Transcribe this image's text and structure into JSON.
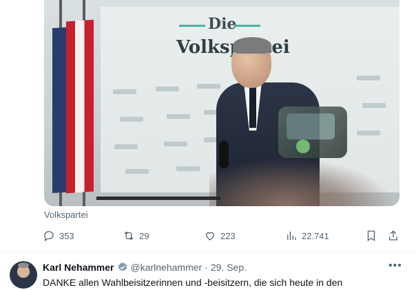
{
  "media": {
    "logo_top": "Die",
    "logo_main": "Volkspartei",
    "source_label": "Volkspartei"
  },
  "actions": {
    "replies": "353",
    "reposts": "29",
    "likes": "223",
    "views": "22.741"
  },
  "next_tweet": {
    "display_name": "Karl Nehammer",
    "handle": "@karlnehammer",
    "separator": "·",
    "date": "29. Sep.",
    "text": "DANKE allen Wahlbeisitzerinnen und -beisitzern, die sich heute in den"
  },
  "colors": {
    "secondary_text": "#536471",
    "primary_text": "#0f1419",
    "verified_badge": "#829aab",
    "brand_teal": "#4fb0a1"
  },
  "icons": [
    "reply-icon",
    "repost-icon",
    "like-icon",
    "views-icon",
    "bookmark-icon",
    "share-icon",
    "verified-icon",
    "more-icon"
  ]
}
